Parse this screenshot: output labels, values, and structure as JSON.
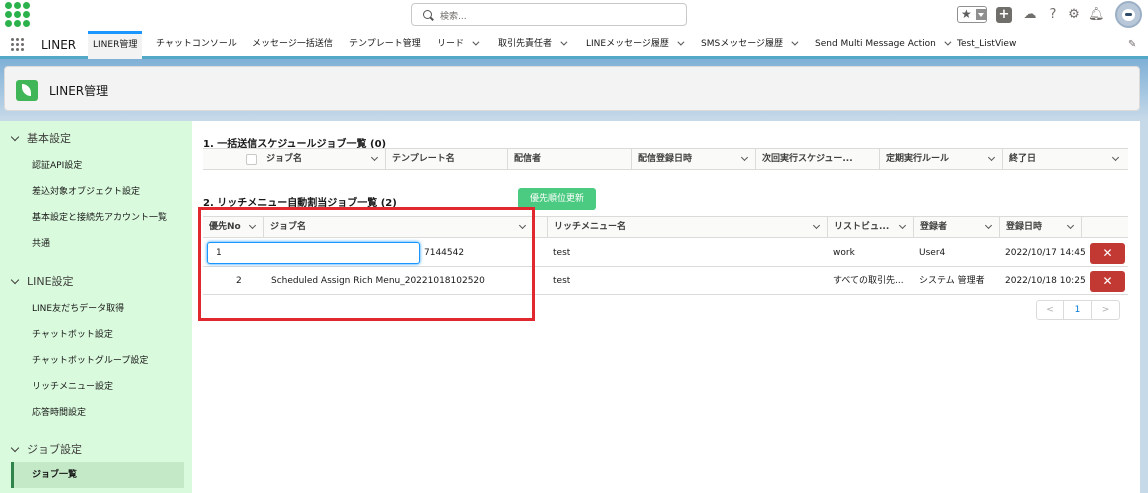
{
  "header": {
    "search_placeholder": "検索...",
    "icons": [
      "favorites-star-icon",
      "add-icon",
      "trailhead-icon",
      "help-icon",
      "setup-gear-icon",
      "notification-bell-icon",
      "avatar"
    ]
  },
  "nav": {
    "app_name": "LINER",
    "tabs": [
      {
        "label": "LINER管理",
        "active": true,
        "dropdown": false
      },
      {
        "label": "チャットコンソール",
        "dropdown": false
      },
      {
        "label": "メッセージ一括送信",
        "dropdown": false
      },
      {
        "label": "テンプレート管理",
        "dropdown": false
      },
      {
        "label": "リード",
        "dropdown": true
      },
      {
        "label": "取引先責任者",
        "dropdown": true
      },
      {
        "label": "LINEメッセージ履歴",
        "dropdown": true
      },
      {
        "label": "SMSメッセージ履歴",
        "dropdown": true
      },
      {
        "label": "Send Multi Message Action",
        "dropdown": true
      },
      {
        "label": "Test_ListView",
        "dropdown": false
      }
    ]
  },
  "page": {
    "title": "LINER管理"
  },
  "sidebar": {
    "sections": [
      {
        "label": "基本設定",
        "items": [
          "認証API設定",
          "差込対象オブジェクト設定",
          "基本設定と接続先アカウント一覧",
          "共通"
        ]
      },
      {
        "label": "LINE設定",
        "items": [
          "LINE友だちデータ取得",
          "チャットボット設定",
          "チャットボットグループ設定",
          "リッチメニュー設定",
          "応答時間設定"
        ]
      },
      {
        "label": "ジョブ設定",
        "items": [
          "ジョブ一覧"
        ]
      }
    ],
    "selected": "ジョブ一覧"
  },
  "section1": {
    "title": "1. 一括送信スケジュールジョブ一覧 (0)",
    "columns": [
      "ジョブ名",
      "テンプレート名",
      "配信者",
      "配信登録日時",
      "次回実行スケジュー...",
      "定期実行ルール",
      "終了日"
    ]
  },
  "section2": {
    "title": "2. リッチメニュー自動割当ジョブ一覧 (2)",
    "priority_button": "優先順位更新",
    "columns": [
      "優先No",
      "ジョブ名",
      "リッチメニュー名",
      "リストビュ...",
      "登録者",
      "登録日時"
    ],
    "rows": [
      {
        "priority": "1",
        "job_suffix": "7144542",
        "rich_menu": "test",
        "list_view": "work",
        "registrant": "User4",
        "registered_at": "2022/10/17 14:45"
      },
      {
        "priority": "2",
        "job": "Scheduled Assign Rich Menu_20221018102520",
        "rich_menu": "test",
        "list_view": "すべての取引先...",
        "registrant": "システム 管理者",
        "registered_at": "2022/10/18 10:25"
      }
    ],
    "delete_label": "✕",
    "pager": {
      "prev": "<",
      "page": "1",
      "next": ">"
    }
  }
}
